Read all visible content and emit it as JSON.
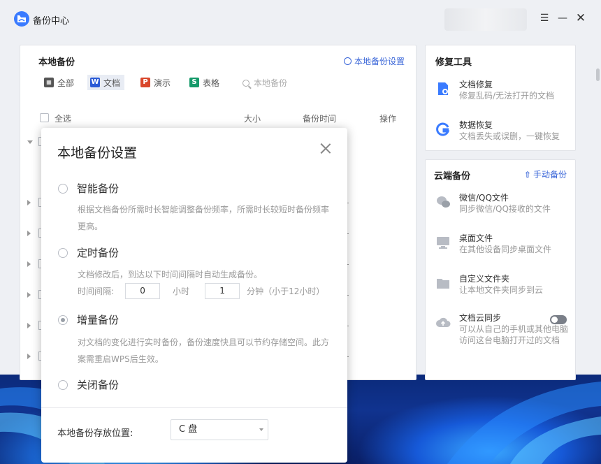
{
  "app": {
    "title": "备份中心"
  },
  "window": {
    "menu_icon": "hamburger-icon",
    "minimize_icon": "minimize-icon",
    "close_icon": "close-icon"
  },
  "local_backup": {
    "title": "本地备份",
    "settings_link": "本地备份设置",
    "tabs": [
      {
        "label": "全部",
        "icon": "grid-icon",
        "icon_text": "",
        "color": "#555555"
      },
      {
        "label": "文档",
        "icon": "word-icon",
        "icon_text": "W",
        "color": "#2b5bd6",
        "active": true
      },
      {
        "label": "演示",
        "icon": "ppt-icon",
        "icon_text": "P",
        "color": "#d9472b"
      },
      {
        "label": "表格",
        "icon": "excel-icon",
        "icon_text": "S",
        "color": "#159a6a"
      }
    ],
    "search_placeholder": "本地备份",
    "columns": {
      "select_all": "全选",
      "size": "大小",
      "backup_time": "备份时间",
      "action": "操作"
    }
  },
  "repair_tools": {
    "title": "修复工具",
    "items": [
      {
        "title": "文档修复",
        "desc": "修复乱码/无法打开的文档",
        "icon": "doc-repair-icon"
      },
      {
        "title": "数据恢复",
        "desc": "文档丢失或误删，一键恢复",
        "icon": "data-recovery-icon"
      }
    ]
  },
  "cloud_backup": {
    "title": "云端备份",
    "manual_button": "手动备份",
    "items": [
      {
        "title": "微信/QQ文件",
        "desc": "同步微信/QQ接收的文件",
        "icon": "wechat-qq-icon"
      },
      {
        "title": "桌面文件",
        "desc": "在其他设备同步桌面文件",
        "icon": "desktop-icon"
      },
      {
        "title": "自定义文件夹",
        "desc": "让本地文件夹同步到云",
        "icon": "folder-icon"
      },
      {
        "title": "文档云同步",
        "desc": "可以从自己的手机或其他电脑访问这台电脑打开过的文档",
        "icon": "cloud-upload-icon",
        "toggle": false
      }
    ]
  },
  "dialog": {
    "title": "本地备份设置",
    "options": [
      {
        "label": "智能备份",
        "desc": "根据文档备份所需时长智能调整备份频率，所需时长较短时备份频率更高。",
        "selected": false
      },
      {
        "label": "定时备份",
        "desc": "文档修改后，到达以下时间间隔时自动生成备份。",
        "selected": false
      },
      {
        "label": "增量备份",
        "desc": "对文档的变化进行实时备份，备份速度快且可以节约存储空间。此方案需重启WPS后生效。",
        "selected": true
      },
      {
        "label": "关闭备份",
        "desc": "",
        "selected": false
      }
    ],
    "interval": {
      "label": "时间间隔:",
      "hours": "0",
      "hours_unit": "小时",
      "minutes": "1",
      "minutes_unit": "分钟（小于12小时）"
    },
    "location": {
      "label": "本地备份存放位置:",
      "value": "C 盘"
    }
  }
}
